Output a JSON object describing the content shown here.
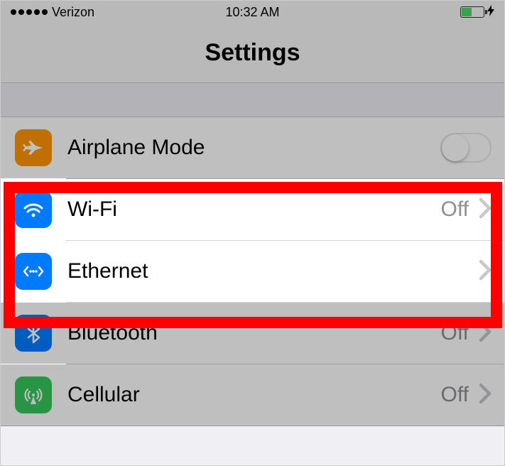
{
  "status": {
    "carrier": "Verizon",
    "time": "10:32 AM"
  },
  "title": "Settings",
  "rows": {
    "airplane": {
      "label": "Airplane Mode"
    },
    "wifi": {
      "label": "Wi-Fi",
      "value": "Off"
    },
    "ethernet": {
      "label": "Ethernet"
    },
    "bluetooth": {
      "label": "Bluetooth",
      "value": "Off"
    },
    "cellular": {
      "label": "Cellular",
      "value": "Off"
    }
  }
}
